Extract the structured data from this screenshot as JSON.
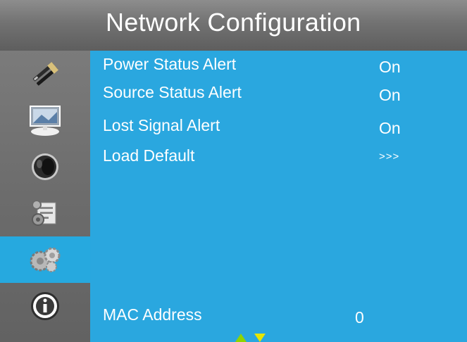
{
  "header": {
    "title": "Network Configuration"
  },
  "sidebar": {
    "items": [
      {
        "icon": "tools-icon",
        "active": false
      },
      {
        "icon": "picture-icon",
        "active": false
      },
      {
        "icon": "audio-icon",
        "active": false
      },
      {
        "icon": "setup-icon",
        "active": false
      },
      {
        "icon": "network-icon",
        "active": true
      },
      {
        "icon": "info-icon",
        "active": false
      }
    ]
  },
  "menu": {
    "items": [
      {
        "label": "Power Status Alert",
        "value": "On"
      },
      {
        "label": "Source Status Alert",
        "value": "On"
      },
      {
        "label": "Lost Signal Alert",
        "value": "On"
      },
      {
        "label": "Load Default",
        "value": ">>>"
      }
    ],
    "mac": {
      "label": "MAC Address",
      "value": "0"
    }
  },
  "colors": {
    "panel_blue": "#2aa7df",
    "active_blue": "#26a9df",
    "nav_arrow_green": "#8fd400",
    "nav_arrow_yellow": "#e6e600"
  }
}
